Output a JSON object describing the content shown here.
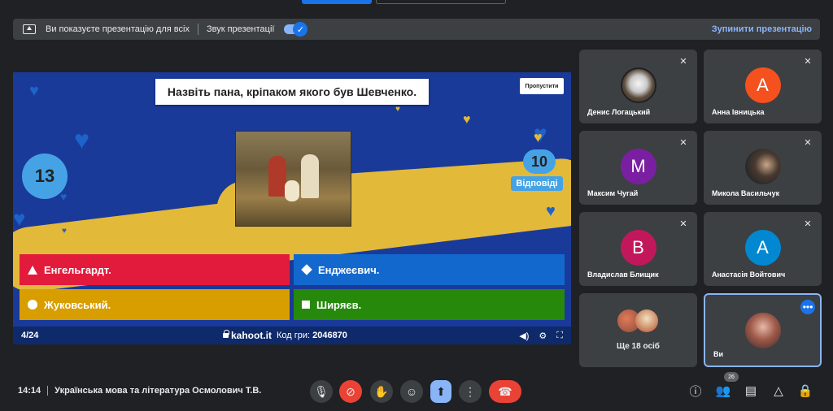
{
  "presentation_bar": {
    "message": "Ви показуєте презентацію для всіх",
    "sound_label": "Звук презентації",
    "stop_label": "Зупинити презентацію"
  },
  "kahoot": {
    "question": "Назвіть пана,  кріпаком якого був Шевченко.",
    "skip_label": "Пропустити",
    "timer": "13",
    "answers_count": "10",
    "answers_label": "Відповіді",
    "answers": [
      {
        "text": "Енгельгардт.",
        "shape": "triangle",
        "color": "#e21b3c"
      },
      {
        "text": "Енджеєвич.",
        "shape": "diamond",
        "color": "#1368ce"
      },
      {
        "text": "Жуковський.",
        "shape": "circle",
        "color": "#d89e00"
      },
      {
        "text": "Ширяєв.",
        "shape": "square",
        "color": "#26890c"
      }
    ],
    "progress": "4/24",
    "url": "kahoot.it",
    "pin_label": "Код гри:",
    "pin": "2046870"
  },
  "participants": [
    {
      "name": "Денис Логацький",
      "avatar_type": "photo-dog",
      "muted": true
    },
    {
      "name": "Анна Івницька",
      "initial": "А",
      "color": "#f4511e",
      "muted": true
    },
    {
      "name": "Максим Чугай",
      "initial": "М",
      "color": "#7b1fa2",
      "muted": true
    },
    {
      "name": "Микола Васильчук",
      "avatar_type": "photo",
      "muted": true
    },
    {
      "name": "Владислав Блищик",
      "initial": "В",
      "color": "#c2185b",
      "muted": true
    },
    {
      "name": "Анастасія Войтович",
      "initial": "А",
      "color": "#0288d1",
      "muted": true
    }
  ],
  "others_label": "Ще 18 осіб",
  "self_label": "Ви",
  "footer": {
    "time": "14:14",
    "meeting_title": "Українська мова та література Осмолович Т.В.",
    "people_count": "26"
  },
  "icons": {
    "mic": "mic-icon",
    "camera_off": "camera-off-icon",
    "hand": "raise-hand-icon",
    "emoji": "emoji-icon",
    "present": "present-icon",
    "more": "more-options-icon",
    "end_call": "end-call-icon",
    "info": "info-icon",
    "people": "people-icon",
    "chat": "chat-icon",
    "activities": "activities-icon",
    "host": "host-controls-icon"
  }
}
